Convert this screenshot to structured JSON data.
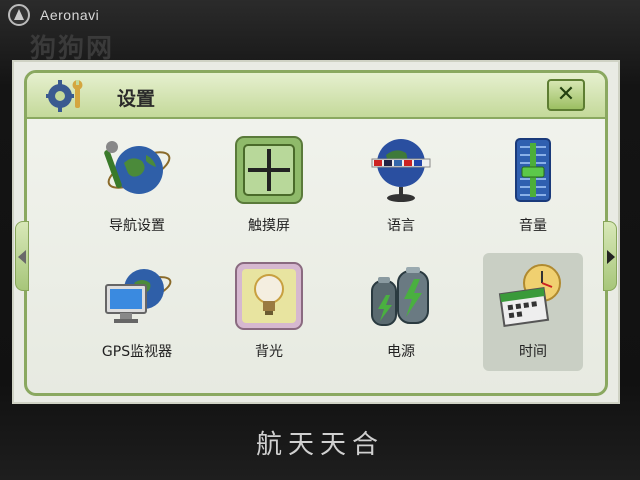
{
  "device": {
    "brand": "Aeronavi",
    "watermark": "狗狗网",
    "bottom_brand": "航天天合"
  },
  "header": {
    "title": "设置",
    "close_label": "✕"
  },
  "menu": {
    "items": [
      {
        "label": "导航设置",
        "icon": "globe-wrench-icon"
      },
      {
        "label": "触摸屏",
        "icon": "crosshair-icon"
      },
      {
        "label": "语言",
        "icon": "language-globe-icon"
      },
      {
        "label": "音量",
        "icon": "volume-slider-icon"
      },
      {
        "label": "GPS监视器",
        "icon": "gps-monitor-icon"
      },
      {
        "label": "背光",
        "icon": "lightbulb-icon"
      },
      {
        "label": "电源",
        "icon": "battery-icon"
      },
      {
        "label": "时间",
        "icon": "clock-calendar-icon"
      }
    ],
    "selected_index": 7
  },
  "colors": {
    "accent": "#8aa860",
    "header": "#c4d99a",
    "screen_bg": "#e9ebe4",
    "selected_tile": "#c9cfc4"
  }
}
